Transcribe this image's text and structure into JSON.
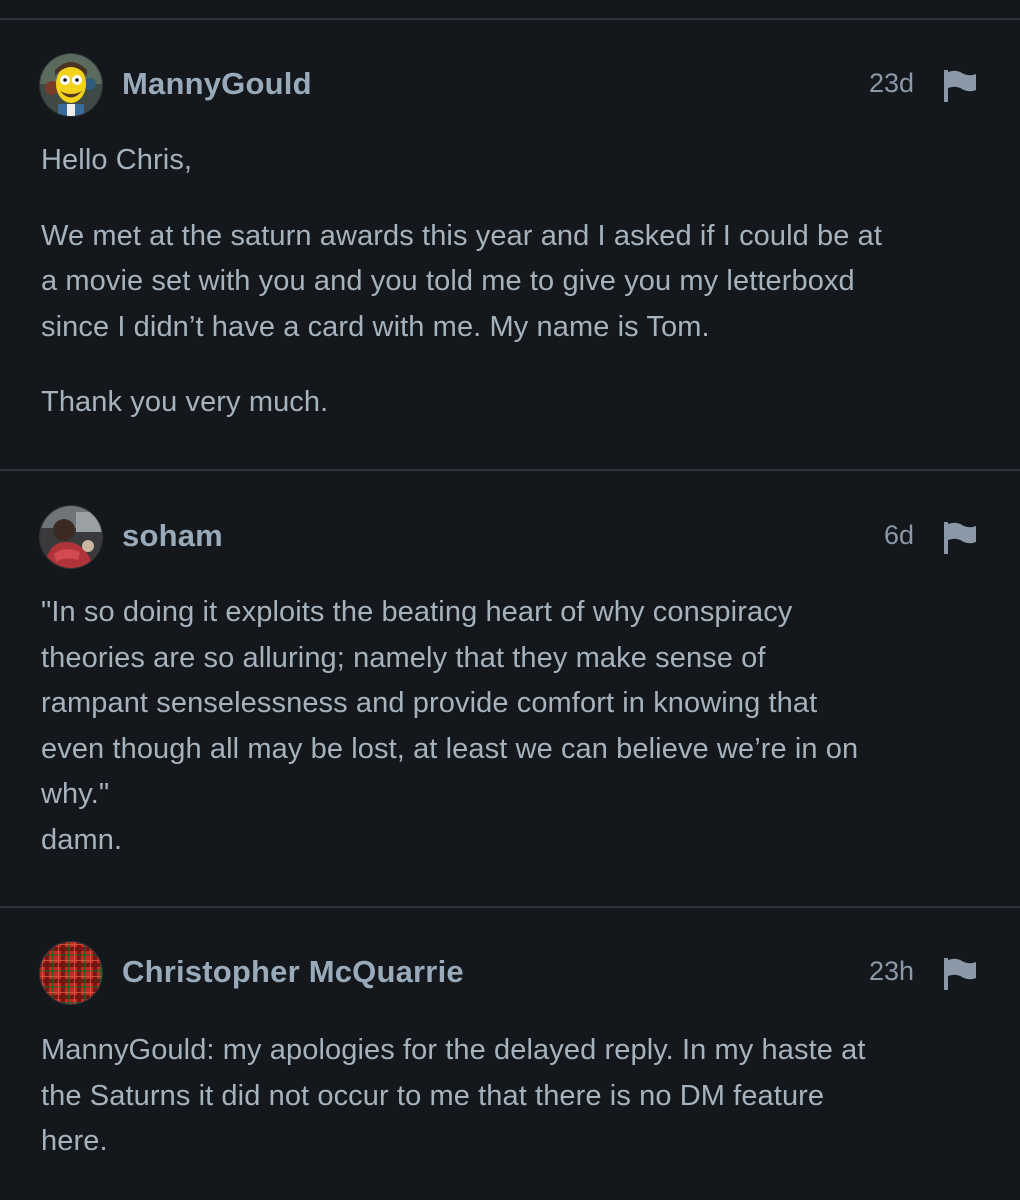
{
  "colors": {
    "background": "#14181c",
    "divider": "#2c3440",
    "username": "#99aabb",
    "text": "#a6b2be",
    "meta": "#8a98a8"
  },
  "comments": [
    {
      "username": "MannyGould",
      "time": "23d",
      "avatar_icon": "cartoon-avatar-icon",
      "flag_icon": "flag-icon",
      "paragraphs": [
        [
          "Hello Chris,"
        ],
        [
          "We met at the saturn awards this year and I asked if I could be at",
          "a movie set with you and you told me to give you my letterboxd",
          "since I didn’t have a card with me. My name is Tom."
        ],
        [
          "Thank you very much."
        ]
      ]
    },
    {
      "username": "soham",
      "time": "6d",
      "avatar_icon": "photo-avatar-icon",
      "flag_icon": "flag-icon",
      "paragraphs": [
        [
          "\"In so doing it exploits the beating heart of why conspiracy",
          "theories are so alluring; namely that they make sense of",
          "rampant senselessness and provide comfort in knowing that",
          "even though all may be lost, at least we can believe we’re in on",
          "why.\"",
          "damn."
        ]
      ]
    },
    {
      "username": "Christopher McQuarrie",
      "time": "23h",
      "avatar_icon": "tartan-avatar-icon",
      "flag_icon": "flag-icon",
      "paragraphs": [
        [
          "MannyGould: my apologies for the delayed reply. In my haste at",
          "the Saturns it did not occur to me that there is no DM feature",
          "here."
        ]
      ]
    }
  ]
}
